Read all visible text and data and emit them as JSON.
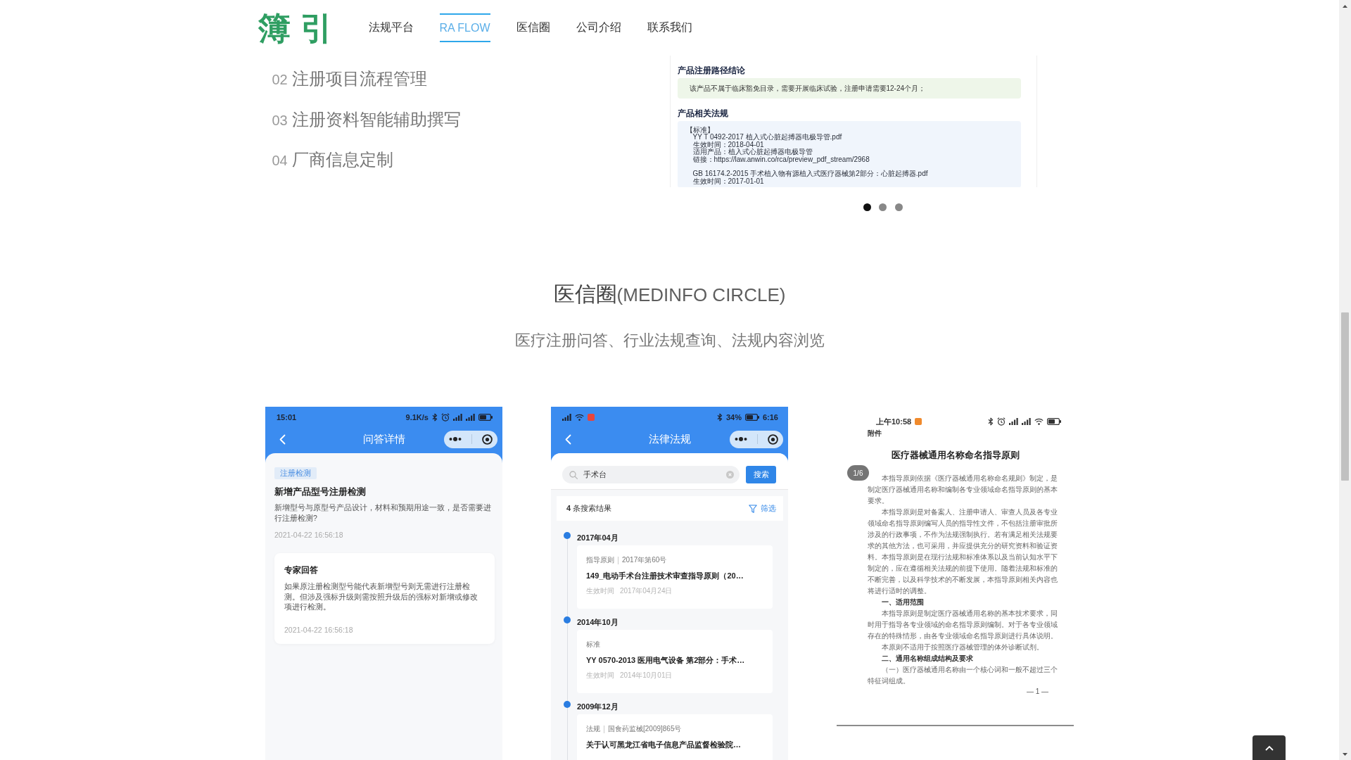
{
  "header": {
    "logo": "簿引",
    "nav": [
      {
        "label": "法规平台",
        "selected": false
      },
      {
        "label": "RA FLOW",
        "selected": true
      },
      {
        "label": "医信圈",
        "selected": false
      },
      {
        "label": "公司介绍",
        "selected": false
      },
      {
        "label": "联系我们",
        "selected": false
      }
    ]
  },
  "features": [
    {
      "number": "02",
      "title": "注册项目流程管理"
    },
    {
      "number": "03",
      "title": "注册资料智能辅助撰写"
    },
    {
      "number": "04",
      "title": "厂商信息定制"
    }
  ],
  "preview": {
    "conclusion_heading": "产品注册路径结论",
    "conclusion": "该产品不属于临床豁免目录，需要开展临床试验，注册申请需要12-24个月；",
    "regulations_heading": "产品相关法规",
    "category": "【标准】",
    "documents": [
      {
        "lines": [
          "YY T 0492-2017 植入式心脏起搏器电极导管.pdf",
          "生效时间：2018-04-01",
          "适用产品：植入式心脏起搏器电极导管",
          "链接：https://law.anwin.co/rca/preview_pdf_stream/2968"
        ]
      },
      {
        "lines": [
          "GB 16174.2-2015 手术植入物有源植入式医疗器械第2部分：心脏起搏器.pdf",
          "生效时间：2017-01-01"
        ]
      }
    ]
  },
  "carousel_dots": [
    {
      "selected": true
    },
    {
      "selected": false
    },
    {
      "selected": false
    }
  ],
  "medinfo": {
    "title": "医信圈",
    "title_en": "(MEDINFO CIRCLE)",
    "subtitle": "医疗注册问答、行业法规查询、法规内容浏览",
    "screens": [
      {
        "kind": "qa_detail",
        "status": {
          "time": "15:01",
          "speed": "9.1K/s"
        },
        "title": "问答详情",
        "tag": "注册检测",
        "question_title": "新增产品型号注册检测",
        "question": "新增型号与原型号产品设计，材料和预期用途一致，是否需要进行注册检测?",
        "asked_at": "2021-04-22 16:56:18",
        "answer_heading": "专家回答",
        "answer": "如果原注册检测型号能代表新增型号则无需进行注册检测。但涉及强标升级则需按照升级后的强标对新增或修改项进行检测。",
        "answered_at": "2021-04-22 16:56:18"
      },
      {
        "kind": "regulation_search",
        "status": {
          "battery": "34%",
          "time": "6:16"
        },
        "title": "法律法规",
        "search": {
          "value": "手术台"
        },
        "search_button": "搜索",
        "result_count": "**4** 条搜索结果",
        "filter": "筛选",
        "results": [
          {
            "month": "2017年04月",
            "category": "指导原则",
            "number": "2017年第60号",
            "title": "149_电动手术台注册技术审查指导原则（20…",
            "effective_label": "生效时间",
            "effective_date": "2017年04月24日"
          },
          {
            "month": "2014年10月",
            "category": "标准",
            "title": "YY 0570-2013 医用电气设备 第2部分：手术…",
            "effective_label": "生效时间",
            "effective_date": "2014年10月01日"
          },
          {
            "month": "2009年12月",
            "category": "法规",
            "number": "国食药监械[2009]865号",
            "title": "关于认可黑龙江省电子信息产品监督检验院…"
          }
        ]
      },
      {
        "kind": "document",
        "status": {
          "time": "上午10:58"
        },
        "attachment_label": "附件",
        "title": "医疗器械通用名称命名指导原则",
        "page_badge": "1/6",
        "paragraphs": [
          {
            "kind": "body",
            "text": "本指导原则依据《医疗器械通用名称命名规则》制定，是制定医疗器械通用名称和编制各专业领域命名指导原则的基本要求。"
          },
          {
            "kind": "body",
            "text": "本指导原则是对备案人、注册申请人、审查人员及各专业领域命名指导原则编写人员的指导性文件，不包括注册审批所涉及的行政事项，不作为法规强制执行。若有满足相关法规要求的其他方法，也可采用，并应提供充分的研究资料和验证资料。本指导原则是在现行法规和标准体系以及当前认知水平下制定的，应在遵循相关法规的前提下使用。随着法规和标准的不断完善，以及科学技术的不断发展，本指导原则相关内容也将进行适时的调整。"
          },
          {
            "kind": "heading",
            "text": "一、适用范围"
          },
          {
            "kind": "body",
            "text": "本指导原则是制定医疗器械通用名称的基本技术要求，同时用于指导各专业领域的命名指导原则编制。对于各专业领域存在的特殊情形，由各专业领域命名指导原则进行具体说明。"
          },
          {
            "kind": "body",
            "text": "本原则不适用于按照医疗器械管理的体外诊断试剂。"
          },
          {
            "kind": "heading",
            "text": "二、通用名称组成结构及要求"
          },
          {
            "kind": "body",
            "text": "（一）医疗器械通用名称由一个核心词和一般不超过三个特征词组成。"
          }
        ],
        "page_number": "— 1 —"
      }
    ]
  }
}
